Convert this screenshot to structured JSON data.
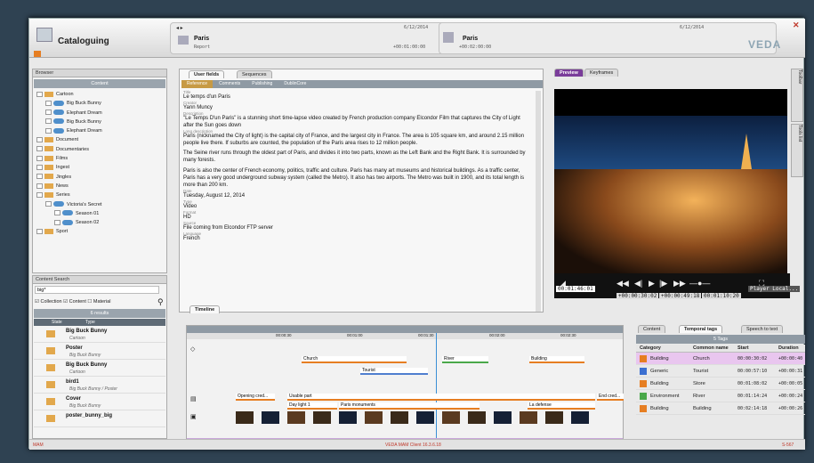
{
  "app": {
    "title": "Cataloguing",
    "logo": "VEDA",
    "close": "✕"
  },
  "header1": {
    "title": "Paris",
    "subtitle": "Report",
    "date": "6/12/2014",
    "time": "+00:01:00:00"
  },
  "header2": {
    "title": "Paris",
    "date": "6/12/2014",
    "time": "+00:02:00:00"
  },
  "browser": {
    "title": "Browser",
    "content_header": "Content",
    "tree": [
      {
        "label": "Cartoon",
        "level": 0,
        "kind": "folder"
      },
      {
        "label": "Big Buck Bunny",
        "level": 1,
        "kind": "clip"
      },
      {
        "label": "Elephant Dream",
        "level": 1,
        "kind": "clip"
      },
      {
        "label": "Big Buck Bunny",
        "level": 1,
        "kind": "clip"
      },
      {
        "label": "Elephant Dream",
        "level": 1,
        "kind": "clip"
      },
      {
        "label": "Document",
        "level": 0,
        "kind": "folder"
      },
      {
        "label": "Documentaries",
        "level": 0,
        "kind": "folder"
      },
      {
        "label": "Films",
        "level": 0,
        "kind": "folder"
      },
      {
        "label": "Ingest",
        "level": 0,
        "kind": "folder"
      },
      {
        "label": "Jingles",
        "level": 0,
        "kind": "folder"
      },
      {
        "label": "News",
        "level": 0,
        "kind": "folder"
      },
      {
        "label": "Series",
        "level": 0,
        "kind": "folder"
      },
      {
        "label": "Victoria's Secret",
        "level": 1,
        "kind": "clip"
      },
      {
        "label": "Season 01",
        "level": 2,
        "kind": "clip"
      },
      {
        "label": "Season 02",
        "level": 2,
        "kind": "clip"
      },
      {
        "label": "Sport",
        "level": 0,
        "kind": "folder"
      }
    ]
  },
  "search": {
    "title": "Content Search",
    "query": "big*",
    "options": [
      "Collection",
      "Content",
      "Material"
    ],
    "results_label": "6 results",
    "col_state": "State",
    "col_type": "Type",
    "results": [
      {
        "title": "Big Buck Bunny",
        "sub": "Cartoon"
      },
      {
        "title": "Poster",
        "sub": "Big Buck Bunny"
      },
      {
        "title": "Big Buck Bunny",
        "sub": "Cartoon"
      },
      {
        "title": "bird1",
        "sub": "Big Buck Bunny / Poster"
      },
      {
        "title": "Cover",
        "sub": "Big Buck Bunny"
      },
      {
        "title": "poster_bunny_big",
        "sub": ""
      }
    ]
  },
  "metadata": {
    "tabs": [
      "User fields",
      "Sequences"
    ],
    "subtabs": [
      "Reference",
      "Comments",
      "Publishing",
      "DublinCore"
    ],
    "fields": [
      {
        "label": "Title",
        "value": "Le temps d'un Paris"
      },
      {
        "label": "Creator",
        "value": "Yann Muncy"
      },
      {
        "label": "Description",
        "value": "\"Le Temps D'un Paris\" is a stunning short time-lapse video created by French production company Elcondor Film that captures the City of Light after the Sun goes down"
      },
      {
        "label": "Long description",
        "value": "Paris (nicknamed the City of light) is the capital city of France, and the largest city in France. The area is 105 square km, and around 2.15 million people live there. If suburbs are counted, the population of the Paris area rises to 12 million people."
      },
      {
        "label": "",
        "value": "The Seine river runs through the oldest part of Paris, and divides it into two parts, known as the Left Bank and the Right Bank. It is surrounded by many forests."
      },
      {
        "label": "",
        "value": "Paris is also the center of French economy, politics, traffic and culture. Paris has many art museums and historical buildings. As a traffic center, Paris has a very good underground subway system (called the Metro). It also has two airports. The Metro was built in 1900, and its total length is more than 200 km."
      },
      {
        "label": "Date",
        "value": "Tuesday, August 12, 2014"
      },
      {
        "label": "Type",
        "value": "Video"
      },
      {
        "label": "Format",
        "value": "HD"
      },
      {
        "label": "Source",
        "value": "File coming from Elcondor FTP server"
      },
      {
        "label": "Language",
        "value": "French"
      }
    ]
  },
  "preview": {
    "tabs": [
      "Preview",
      "Keyframes"
    ],
    "timecode": "00:01:46:01",
    "tc_in": "+00:00:30:02",
    "tc_mid": "+00:00:49:18",
    "tc_out": "00:01:10:20",
    "player_local": "Player Local...",
    "side_tabs": [
      "Toolbar",
      "Tools list"
    ]
  },
  "timeline": {
    "tab": "Timeline",
    "ruler": [
      "00:00:30",
      "00:01:00",
      "00:01:30",
      "00:02:00",
      "00:02:30"
    ],
    "tags": [
      {
        "label": "Church",
        "color": "orange"
      },
      {
        "label": "Tourist",
        "color": "blue"
      },
      {
        "label": "River",
        "color": "green"
      },
      {
        "label": "Building",
        "color": "orange"
      }
    ],
    "sequences": [
      "Opening cred...",
      "Usable part",
      "End cred...",
      "Day light 1",
      "Paris monuments",
      "La defense"
    ]
  },
  "tags_panel": {
    "tabs": [
      "Content",
      "Temporal tags",
      "Speech to text"
    ],
    "count_label": "5 Tags",
    "columns": [
      "Category",
      "Common name",
      "Start",
      "Duration"
    ],
    "rows": [
      {
        "category": "Building",
        "name": "Church",
        "start": "00:00:30:02",
        "duration": "+00:00:40"
      },
      {
        "category": "Generic",
        "name": "Tourist",
        "start": "00:00:57:10",
        "duration": "+00:00:31"
      },
      {
        "category": "Building",
        "name": "Store",
        "start": "00:01:08:02",
        "duration": "+00:00:05"
      },
      {
        "category": "Environment",
        "name": "River",
        "start": "00:01:14:24",
        "duration": "+00:00:24"
      },
      {
        "category": "Building",
        "name": "Building",
        "start": "00:02:14:18",
        "duration": "+00:00:26"
      }
    ]
  },
  "status": {
    "left": "MAM",
    "center": "VEDA MAM Client 16.3.6.18",
    "right": "S-567"
  }
}
